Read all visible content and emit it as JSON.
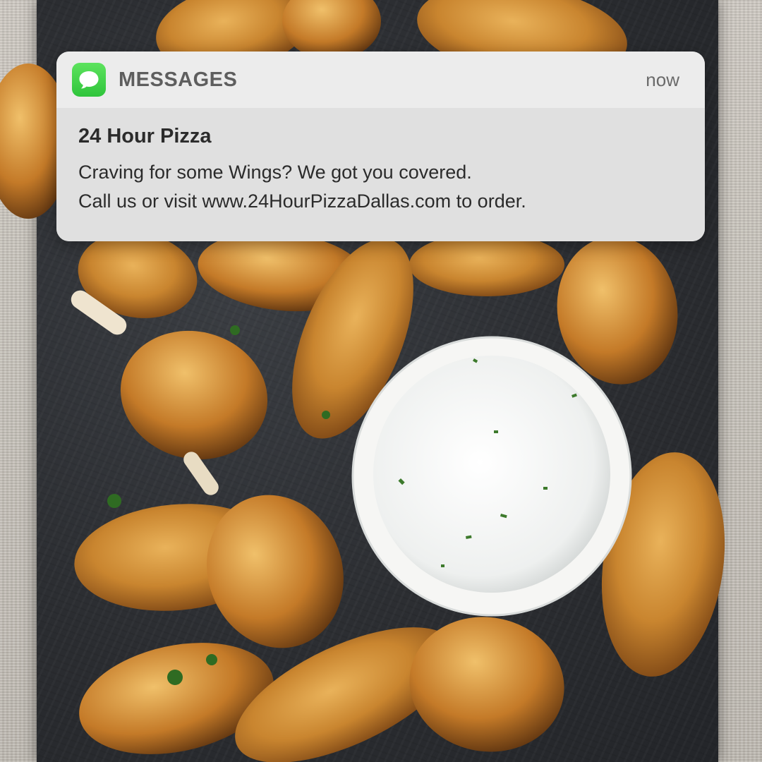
{
  "notification": {
    "app_name": "MESSAGES",
    "time": "now",
    "sender": "24 Hour Pizza",
    "message_line1": "Craving for some Wings? We got you covered.",
    "message_line2": "Call us or visit www.24HourPizzaDallas.com to order.",
    "icon": "messages-app-icon",
    "icon_color": "#34C759"
  },
  "background": {
    "icon": "chicken-wings-with-dip-photo"
  }
}
